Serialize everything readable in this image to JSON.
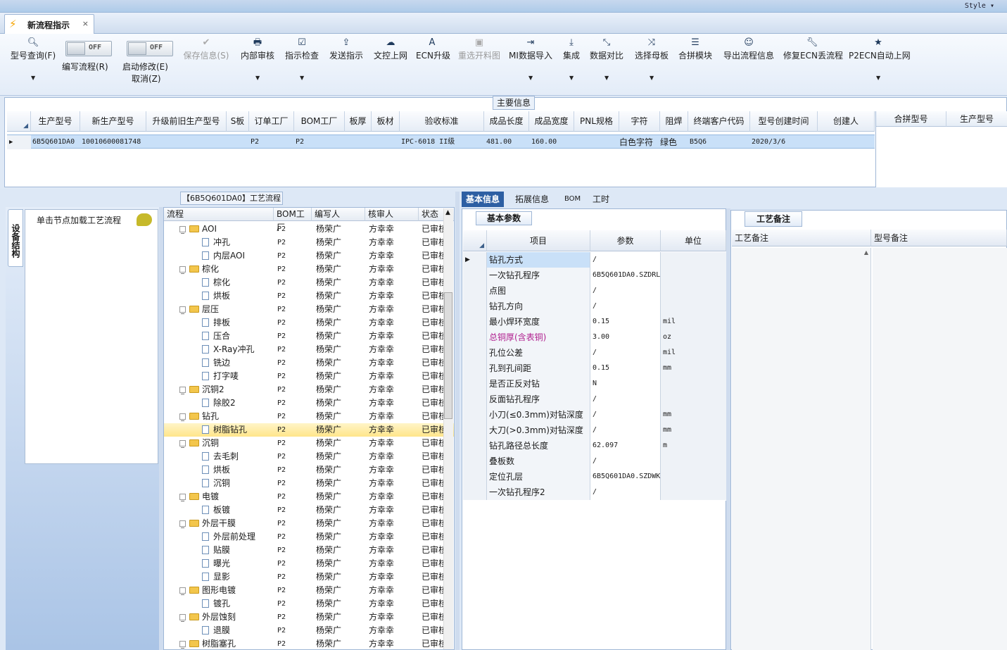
{
  "window": {
    "style_label": "Style"
  },
  "doc_tab": {
    "title": "新流程指示",
    "close": "×"
  },
  "toolbar": {
    "query": "型号查询(F)",
    "switch1": {
      "state": "OFF",
      "label": "编写流程(R)"
    },
    "switch2": {
      "state": "OFF",
      "label1": "启动修改(E)",
      "label2": "取消(Z)"
    },
    "save": "保存信息(S)",
    "review": "内部审核",
    "check": "指示检查",
    "send": "发送指示",
    "doc_upload": "文控上网",
    "ecn_upgrade": "ECN升级",
    "reselect_drawing": "重选开料图",
    "mi_import": "MI数据导入",
    "integrate": "集成",
    "compare": "数据对比",
    "select_mother": "选择母板",
    "merge_module": "合拼模块",
    "export_flow": "导出流程信息",
    "fix_ecn": "修复ECN丢流程",
    "p2ecn_upload": "P2ECN自动上网"
  },
  "main_info": {
    "caption": "主要信息",
    "columns": [
      "生产型号",
      "新生产型号",
      "升级前旧生产型号",
      "S板",
      "订单工厂",
      "BOM工厂",
      "板厚",
      "板材",
      "验收标准",
      "成品长度",
      "成品宽度",
      "PNL规格",
      "字符",
      "阻焊",
      "终端客户代码",
      "型号创建时间",
      "创建人"
    ],
    "row": {
      "c0": "6B5Q601DA0",
      "c1": "10010600081748",
      "c2": "",
      "c3": "",
      "c4": "P2",
      "c5": "P2",
      "c6": "",
      "c7": "",
      "c8": "IPC-6018 II级",
      "c9": "481.00",
      "c10": "160.00",
      "c11": "",
      "c12": "白色字符",
      "c13": "绿色",
      "c14": "B5Q6",
      "c15": "2020/3/6",
      "c16": ""
    },
    "merge_columns": [
      "合拼型号",
      "生产型号"
    ]
  },
  "left_panel": {
    "side_tab": "设备结构",
    "node_hint": "单击节点加载工艺流程"
  },
  "flow_tree": {
    "caption": "【6B5Q601DA0】工艺流程",
    "columns": [
      "流程",
      "BOM工厂",
      "编写人",
      "核审人",
      "状态"
    ],
    "rows": [
      {
        "name": "AOI",
        "folder": true,
        "bom": "P2",
        "writer": "杨荣广",
        "reviewer": "方幸幸",
        "status": "已审核"
      },
      {
        "name": "冲孔",
        "folder": false,
        "bom": "P2",
        "writer": "杨荣广",
        "reviewer": "方幸幸",
        "status": "已审核"
      },
      {
        "name": "内层AOI",
        "folder": false,
        "bom": "P2",
        "writer": "杨荣广",
        "reviewer": "方幸幸",
        "status": "已审核"
      },
      {
        "name": "棕化",
        "folder": true,
        "bom": "P2",
        "writer": "杨荣广",
        "reviewer": "方幸幸",
        "status": "已审核"
      },
      {
        "name": "棕化",
        "folder": false,
        "bom": "P2",
        "writer": "杨荣广",
        "reviewer": "方幸幸",
        "status": "已审核"
      },
      {
        "name": "烘板",
        "folder": false,
        "bom": "P2",
        "writer": "杨荣广",
        "reviewer": "方幸幸",
        "status": "已审核"
      },
      {
        "name": "层压",
        "folder": true,
        "bom": "P2",
        "writer": "杨荣广",
        "reviewer": "方幸幸",
        "status": "已审核"
      },
      {
        "name": "排板",
        "folder": false,
        "bom": "P2",
        "writer": "杨荣广",
        "reviewer": "方幸幸",
        "status": "已审核"
      },
      {
        "name": "压合",
        "folder": false,
        "bom": "P2",
        "writer": "杨荣广",
        "reviewer": "方幸幸",
        "status": "已审核"
      },
      {
        "name": "X-Ray冲孔",
        "folder": false,
        "bom": "P2",
        "writer": "杨荣广",
        "reviewer": "方幸幸",
        "status": "已审核"
      },
      {
        "name": "铣边",
        "folder": false,
        "bom": "P2",
        "writer": "杨荣广",
        "reviewer": "方幸幸",
        "status": "已审核"
      },
      {
        "name": "打字唛",
        "folder": false,
        "bom": "P2",
        "writer": "杨荣广",
        "reviewer": "方幸幸",
        "status": "已审核"
      },
      {
        "name": "沉铜2",
        "folder": true,
        "bom": "P2",
        "writer": "杨荣广",
        "reviewer": "方幸幸",
        "status": "已审核"
      },
      {
        "name": "除胶2",
        "folder": false,
        "bom": "P2",
        "writer": "杨荣广",
        "reviewer": "方幸幸",
        "status": "已审核"
      },
      {
        "name": "钻孔",
        "folder": true,
        "bom": "P2",
        "writer": "杨荣广",
        "reviewer": "方幸幸",
        "status": "已审核"
      },
      {
        "name": "树脂钻孔",
        "folder": false,
        "bom": "P2",
        "writer": "杨荣广",
        "reviewer": "方幸幸",
        "status": "已审核",
        "selected": true
      },
      {
        "name": "沉铜",
        "folder": true,
        "bom": "P2",
        "writer": "杨荣广",
        "reviewer": "方幸幸",
        "status": "已审核"
      },
      {
        "name": "去毛刺",
        "folder": false,
        "bom": "P2",
        "writer": "杨荣广",
        "reviewer": "方幸幸",
        "status": "已审核"
      },
      {
        "name": "烘板",
        "folder": false,
        "bom": "P2",
        "writer": "杨荣广",
        "reviewer": "方幸幸",
        "status": "已审核"
      },
      {
        "name": "沉铜",
        "folder": false,
        "bom": "P2",
        "writer": "杨荣广",
        "reviewer": "方幸幸",
        "status": "已审核"
      },
      {
        "name": "电镀",
        "folder": true,
        "bom": "P2",
        "writer": "杨荣广",
        "reviewer": "方幸幸",
        "status": "已审核"
      },
      {
        "name": "板镀",
        "folder": false,
        "bom": "P2",
        "writer": "杨荣广",
        "reviewer": "方幸幸",
        "status": "已审核"
      },
      {
        "name": "外层干膜",
        "folder": true,
        "bom": "P2",
        "writer": "杨荣广",
        "reviewer": "方幸幸",
        "status": "已审核"
      },
      {
        "name": "外层前处理",
        "folder": false,
        "bom": "P2",
        "writer": "杨荣广",
        "reviewer": "方幸幸",
        "status": "已审核"
      },
      {
        "name": "贴膜",
        "folder": false,
        "bom": "P2",
        "writer": "杨荣广",
        "reviewer": "方幸幸",
        "status": "已审核"
      },
      {
        "name": "曝光",
        "folder": false,
        "bom": "P2",
        "writer": "杨荣广",
        "reviewer": "方幸幸",
        "status": "已审核"
      },
      {
        "name": "显影",
        "folder": false,
        "bom": "P2",
        "writer": "杨荣广",
        "reviewer": "方幸幸",
        "status": "已审核"
      },
      {
        "name": "图形电镀",
        "folder": true,
        "bom": "P2",
        "writer": "杨荣广",
        "reviewer": "方幸幸",
        "status": "已审核"
      },
      {
        "name": "镀孔",
        "folder": false,
        "bom": "P2",
        "writer": "杨荣广",
        "reviewer": "方幸幸",
        "status": "已审核"
      },
      {
        "name": "外层蚀刻",
        "folder": true,
        "bom": "P2",
        "writer": "杨荣广",
        "reviewer": "方幸幸",
        "status": "已审核"
      },
      {
        "name": "退膜",
        "folder": false,
        "bom": "P2",
        "writer": "杨荣广",
        "reviewer": "方幸幸",
        "status": "已审核"
      },
      {
        "name": "树脂塞孔",
        "folder": true,
        "bom": "P2",
        "writer": "杨荣广",
        "reviewer": "方幸幸",
        "status": "已审核"
      }
    ]
  },
  "detail_tabs": [
    "基本信息",
    "拓展信息",
    "BOM",
    "工时"
  ],
  "basic_params": {
    "tab": "基本参数",
    "columns": [
      "项目",
      "参数",
      "单位"
    ],
    "rows": [
      {
        "item": "钻孔方式",
        "value": "/",
        "unit": ""
      },
      {
        "item": "一次钻孔程序",
        "value": "6B5Q601DA0.SZDRL",
        "unit": ""
      },
      {
        "item": "点图",
        "value": "/",
        "unit": ""
      },
      {
        "item": "钻孔方向",
        "value": "/",
        "unit": ""
      },
      {
        "item": "最小焊环宽度",
        "value": "0.15",
        "unit": "mil"
      },
      {
        "item": "总铜厚(含表铜)",
        "value": "3.00",
        "unit": "oz",
        "highlight": true
      },
      {
        "item": "孔位公差",
        "value": "/",
        "unit": "mil"
      },
      {
        "item": "孔到孔间距",
        "value": "0.15",
        "unit": "mm"
      },
      {
        "item": "是否正反对钻",
        "value": "N",
        "unit": ""
      },
      {
        "item": "反面钻孔程序",
        "value": "/",
        "unit": ""
      },
      {
        "item": "小刀(≤0.3mm)对钻深度",
        "value": "/",
        "unit": "mm"
      },
      {
        "item": "大刀(>0.3mm)对钻深度",
        "value": "/",
        "unit": "mm"
      },
      {
        "item": "钻孔路径总长度",
        "value": "62.097",
        "unit": "m"
      },
      {
        "item": "叠板数",
        "value": "/",
        "unit": ""
      },
      {
        "item": "定位孔层",
        "value": "6B5Q601DA0.SZDWK",
        "unit": ""
      },
      {
        "item": "一次钻孔程序2",
        "value": "/",
        "unit": ""
      }
    ]
  },
  "notes": {
    "tab": "工艺备注",
    "columns": [
      "工艺备注",
      "型号备注"
    ]
  },
  "colors": {
    "accent": "#2d5fa3",
    "highlight_text": "#b0208f",
    "selected_row": "#c9e0f8"
  }
}
